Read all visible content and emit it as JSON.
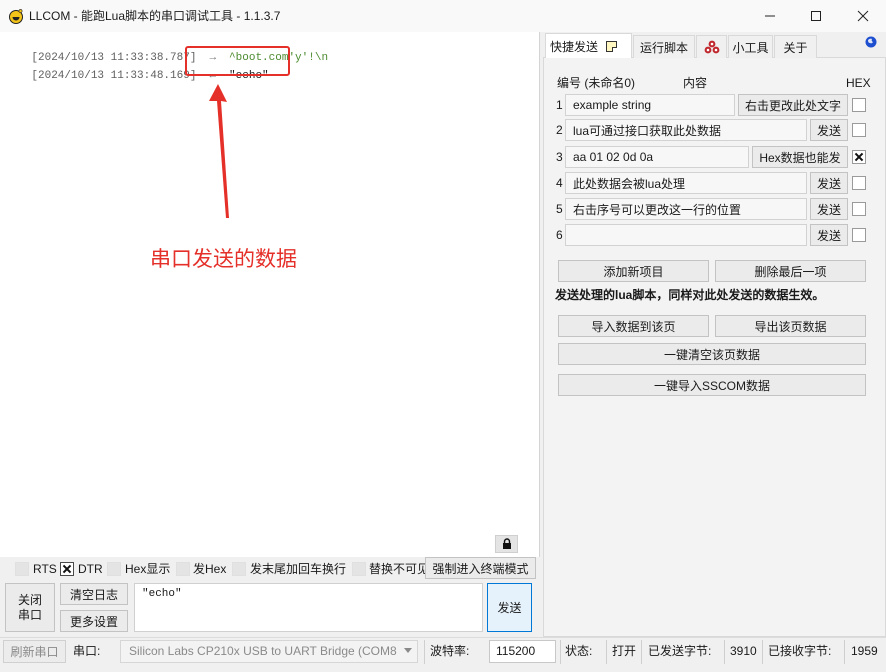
{
  "window": {
    "title": "LLCOM - 能跑Lua脚本的串口调试工具 - 1.1.3.7",
    "app_icon": "llcom-logo-icon",
    "controls": [
      "minimize-icon",
      "maximize-icon",
      "close-icon"
    ]
  },
  "log": {
    "lines": [
      {
        "timestamp": "[2024/10/13 11:33:38.787]",
        "arrow": "→",
        "data": "^boot.com'y'!\\n",
        "color": "#4b8b2e"
      },
      {
        "timestamp": "[2024/10/13 11:33:48.169]",
        "arrow": "←",
        "data": "\"echo\"",
        "color": "#1a1a1a"
      }
    ],
    "lock_icon": "lock-icon"
  },
  "annotation": {
    "label": "串口发送的数据",
    "color": "#e5302a"
  },
  "options": [
    {
      "label": "RTS",
      "checked": false
    },
    {
      "label": "DTR",
      "checked": true
    },
    {
      "label": "Hex显示",
      "checked": false
    },
    {
      "label": "发Hex",
      "checked": false
    },
    {
      "label": "发末尾加回车换行",
      "checked": false
    },
    {
      "label": "替换不可见",
      "checked": false
    }
  ],
  "terminal_mode_button": "强制进入终端模式",
  "send_area": {
    "close_port": [
      "关闭",
      "串口"
    ],
    "clear_log": "清空日志",
    "more_settings": "更多设置",
    "text": "\"echo\"",
    "send": "发送"
  },
  "status_bar": {
    "refresh_ports": "刷新串口",
    "port_label": "串口:",
    "port_value": "Silicon Labs CP210x USB to UART Bridge (COM8",
    "baud_label": "波特率:",
    "baud_value": "115200",
    "state_label": "状态:",
    "state_value": "打开",
    "sent_label": "已发送字节:",
    "sent_value": "3910",
    "received_label": "已接收字节:",
    "received_value": "1959"
  },
  "tabs": [
    {
      "label": "快捷发送",
      "icon": "note-icon",
      "selected": true
    },
    {
      "label": "运行脚本"
    },
    {
      "label": "",
      "icon": "plugin-icon"
    },
    {
      "label": "小工具"
    },
    {
      "label": "关于"
    }
  ],
  "globe_icon": "globe-icon",
  "quick_send": {
    "header": {
      "index": "编号 (未命名0)",
      "content": "内容",
      "hex": "HEX"
    },
    "rows": [
      {
        "index": "1",
        "text": "example string",
        "button": "右击更改此处文字",
        "hex": false
      },
      {
        "index": "2",
        "text": "lua可通过接口获取此处数据",
        "button": "发送",
        "hex": false
      },
      {
        "index": "3",
        "text": "aa 01 02 0d 0a",
        "button": "Hex数据也能发",
        "hex": true
      },
      {
        "index": "4",
        "text": "此处数据会被lua处理",
        "button": "发送",
        "hex": false
      },
      {
        "index": "5",
        "text": "右击序号可以更改这一行的位置",
        "button": "发送",
        "hex": false
      },
      {
        "index": "6",
        "text": "",
        "button": "发送",
        "hex": false
      }
    ],
    "add_item": "添加新项目",
    "remove_last": "删除最后一项",
    "note": "发送处理的lua脚本，同样对此处发送的数据生效。",
    "import_page": "导入数据到该页",
    "export_page": "导出该页数据",
    "clear_page": "一键清空该页数据",
    "import_sscom": "一键导入SSCOM数据"
  }
}
